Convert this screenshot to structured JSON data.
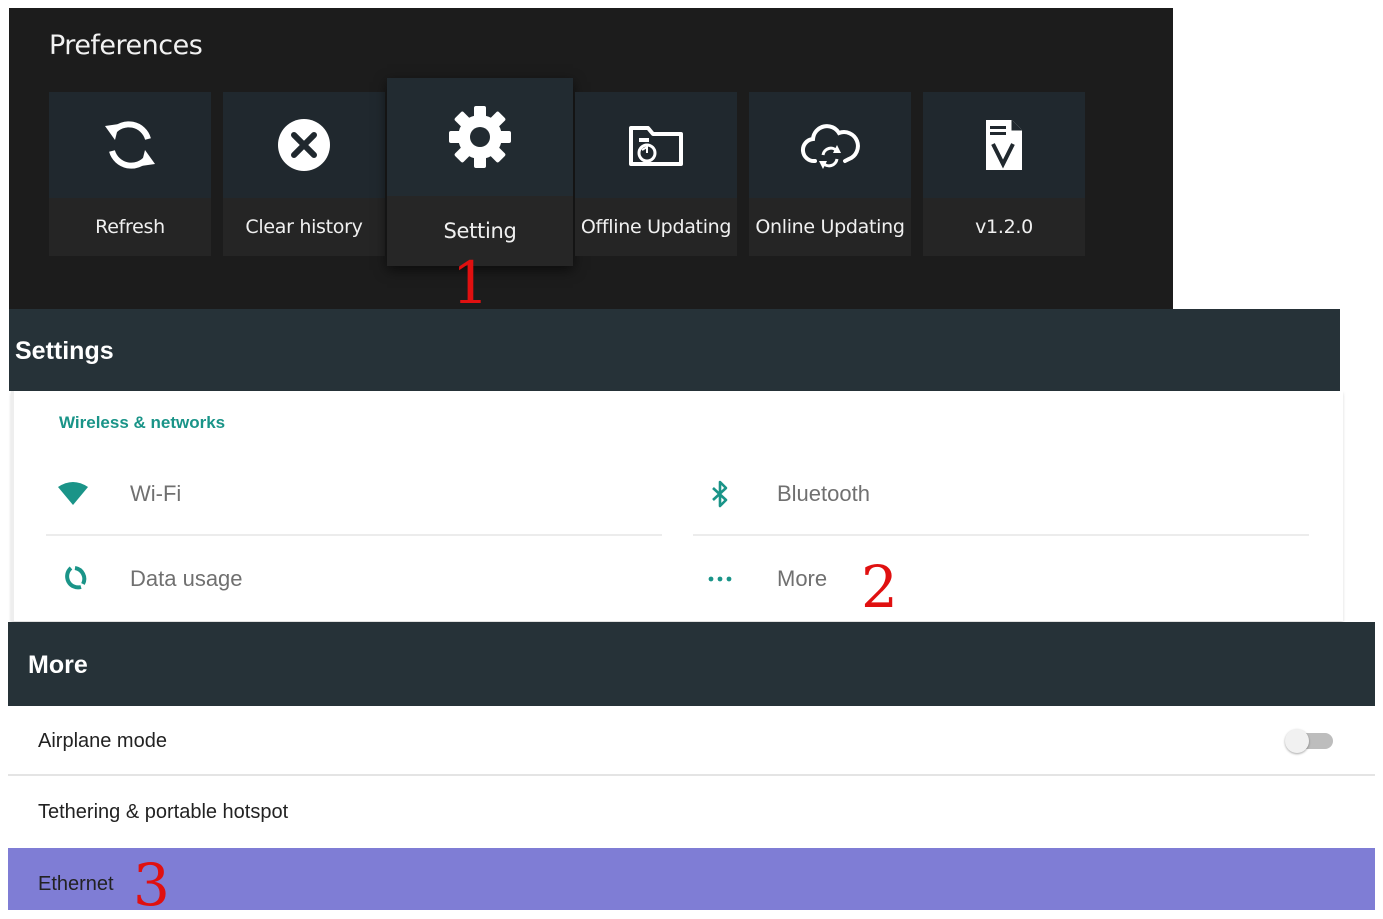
{
  "preferences": {
    "title": "Preferences",
    "tiles": [
      {
        "label": "Refresh",
        "icon": "refresh-icon"
      },
      {
        "label": "Clear history",
        "icon": "close-circle-icon"
      },
      {
        "label": "Setting",
        "icon": "gear-icon",
        "selected": true
      },
      {
        "label": "Offline Updating",
        "icon": "folder-sync-icon"
      },
      {
        "label": "Online Updating",
        "icon": "cloud-sync-icon"
      },
      {
        "label": "v1.2.0",
        "icon": "version-document-icon"
      }
    ]
  },
  "annotations": [
    "1",
    "2",
    "3"
  ],
  "annotation_color": "#e01010",
  "settings": {
    "title": "Settings",
    "category": "Wireless & networks",
    "items": [
      {
        "label": "Wi-Fi",
        "icon": "wifi-icon"
      },
      {
        "label": "Bluetooth",
        "icon": "bluetooth-icon"
      },
      {
        "label": "Data usage",
        "icon": "data-usage-icon"
      },
      {
        "label": "More",
        "icon": "more-dots-icon"
      }
    ],
    "accent_color": "#1a9488",
    "header_color": "#263238"
  },
  "more": {
    "title": "More",
    "rows": [
      {
        "label": "Airplane mode",
        "toggle": "off"
      },
      {
        "label": "Tethering & portable hotspot"
      },
      {
        "label": "Ethernet",
        "highlighted": true
      }
    ],
    "highlight_color": "#7f7dd5"
  }
}
